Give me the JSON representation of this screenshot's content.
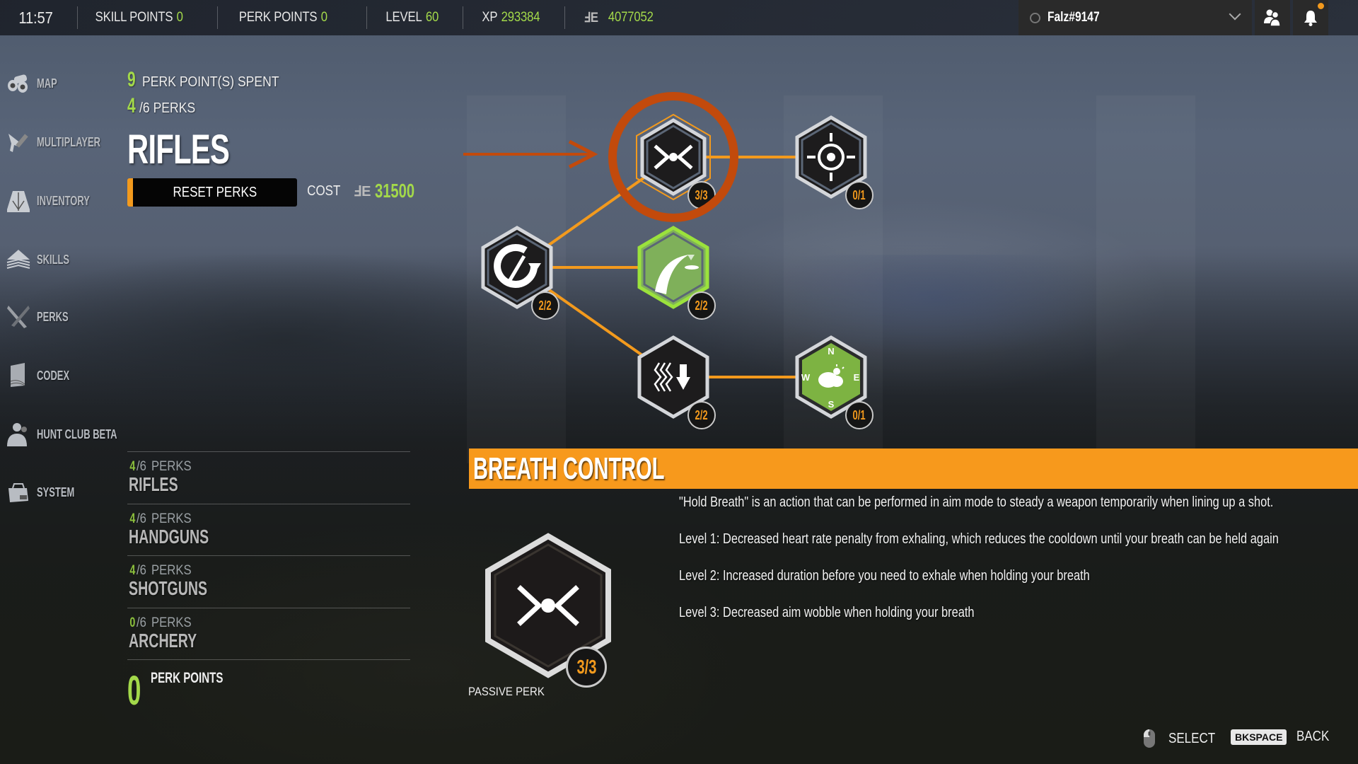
{
  "topbar": {
    "time": "11:57",
    "skill_points_label": "SKILL POINTS",
    "skill_points_value": "0",
    "perk_points_label": "PERK POINTS",
    "perk_points_value": "0",
    "level_label": "LEVEL",
    "level_value": "60",
    "xp_label": "XP",
    "xp_value": "293384",
    "money_icon": "currency-icon",
    "money_symbol": "ℲE",
    "money_value": "4077052",
    "username": "Falz#9147",
    "friends_icon": "friends-icon",
    "notifications_icon": "bell-icon"
  },
  "sidebar": {
    "items": [
      {
        "label": "MAP",
        "icon": "binoculars-icon"
      },
      {
        "label": "MULTIPLAYER",
        "icon": "pistol-icon"
      },
      {
        "label": "INVENTORY",
        "icon": "backpack-icon"
      },
      {
        "label": "SKILLS",
        "icon": "chevrons-up-icon"
      },
      {
        "label": "PERKS",
        "icon": "crossed-knives-icon"
      },
      {
        "label": "CODEX",
        "icon": "book-icon"
      },
      {
        "label": "HUNT CLUB BETA",
        "icon": "hunter-icon"
      },
      {
        "label": "SYSTEM",
        "icon": "toolbox-icon"
      }
    ]
  },
  "summary": {
    "points_spent": "9",
    "points_spent_label": "PERK POINT(S) SPENT",
    "perks_owned": "4",
    "perks_total_label": "/6 PERKS",
    "category_title": "RIFLES",
    "reset_label": "RESET PERKS",
    "cost_label": "COST",
    "cost_symbol": "ℲE",
    "cost_value": "31500"
  },
  "categories": [
    {
      "owned": "4",
      "total": "/6",
      "perks_word": "PERKS",
      "name": "RIFLES"
    },
    {
      "owned": "4",
      "total": "/6",
      "perks_word": "PERKS",
      "name": "HANDGUNS"
    },
    {
      "owned": "4",
      "total": "/6",
      "perks_word": "PERKS",
      "name": "SHOTGUNS"
    },
    {
      "owned": "0",
      "total": "/6",
      "perks_word": "PERKS",
      "name": "ARCHERY"
    }
  ],
  "perk_points": {
    "value": "0",
    "label": "PERK POINTS"
  },
  "perk_tree": {
    "nodes": [
      {
        "id": "breath-control",
        "icon": "breath-control-icon",
        "rank": "3/3",
        "style": "dark",
        "selected": true
      },
      {
        "id": "crosshair",
        "icon": "crosshair-icon",
        "rank": "0/1",
        "style": "dark",
        "selected": false
      },
      {
        "id": "reload",
        "icon": "reload-bullet-icon",
        "rank": "2/2",
        "style": "dark",
        "selected": false
      },
      {
        "id": "trajectory",
        "icon": "bullet-trajectory-icon",
        "rank": "2/2",
        "style": "green",
        "selected": false
      },
      {
        "id": "exhale",
        "icon": "heartrate-down-icon",
        "rank": "2/2",
        "style": "dark",
        "selected": false
      },
      {
        "id": "wind",
        "icon": "compass-weather-icon",
        "rank": "0/1",
        "style": "green-muted",
        "selected": false
      }
    ],
    "compass_letters": [
      "N",
      "E",
      "S",
      "W"
    ]
  },
  "detail": {
    "title": "BREATH CONTROL",
    "lines": [
      "\"Hold Breath\" is an action that can be performed in aim mode to steady a weapon temporarily when lining up a shot.",
      "Level 1: Decreased heart rate penalty from exhaling, which reduces the cooldown until your breath can be held again",
      "Level 2: Increased duration before you need to exhale when holding your breath",
      "Level 3: Decreased aim wobble when holding your breath"
    ],
    "rank": "3/3",
    "type": "PASSIVE PERK"
  },
  "footer": {
    "select_icon": "mouse-icon",
    "select_label": "SELECT",
    "back_key": "BKSPACE",
    "back_label": "BACK"
  },
  "colors": {
    "accent_orange": "#f7991c",
    "accent_green": "#a3d94a",
    "annotation_red": "#c24a0c"
  }
}
